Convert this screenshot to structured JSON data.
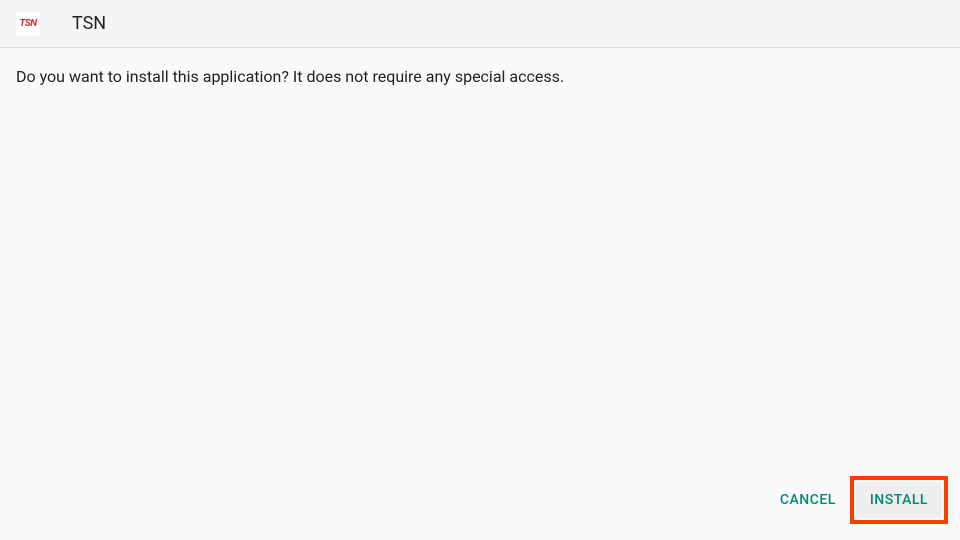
{
  "header": {
    "app_icon_text": "TSN",
    "app_title": "TSN"
  },
  "content": {
    "prompt": "Do you want to install this application? It does not require any special access."
  },
  "buttons": {
    "cancel": "CANCEL",
    "install": "INSTALL"
  }
}
